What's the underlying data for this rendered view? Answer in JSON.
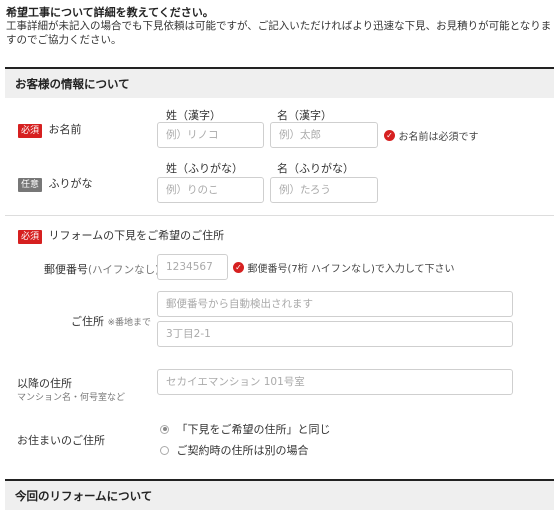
{
  "intro": {
    "title": "希望工事について詳細を教えてください。",
    "text": "工事詳細が未記入の場合でも下見依頼は可能ですが、ご記入いただければより迅速な下見、お見積りが可能となりますのでご協力ください。"
  },
  "customer_section": {
    "heading": "お客様の情報について",
    "name": {
      "badge": "必須",
      "label": "お名前",
      "sei_label": "姓（漢字）",
      "mei_label": "名（漢字）",
      "sei_placeholder": "例）リノコ",
      "mei_placeholder": "例）太郎",
      "error": "お名前は必須です"
    },
    "furigana": {
      "badge": "任意",
      "label": "ふりがな",
      "sei_label": "姓（ふりがな）",
      "mei_label": "名（ふりがな）",
      "sei_placeholder": "例）りのこ",
      "mei_placeholder": "例）たろう"
    }
  },
  "address_section": {
    "badge": "必須",
    "title": "リフォームの下見をご希望のご住所",
    "postal": {
      "label": "郵便番号",
      "label_note": "(ハイフンなし)",
      "placeholder": "1234567",
      "error": "郵便番号(7桁 ハイフンなし)で入力して下さい"
    },
    "address": {
      "label": "ご住所",
      "label_note": "※番地まで",
      "auto_placeholder": "郵便番号から自動検出されます",
      "street_placeholder": "3丁目2-1"
    },
    "building": {
      "label": "以降の住所",
      "label_note": "マンション名・何号室など",
      "placeholder": "セカイエマンション 101号室"
    },
    "residence": {
      "label": "お住まいのご住所",
      "options": [
        "「下見をご希望の住所」と同じ",
        "ご契約時の住所は別の場合"
      ],
      "selected_index": 0
    }
  },
  "reform_section": {
    "heading": "今回のリフォームについて"
  },
  "colors": {
    "required_badge": "#d62020",
    "optional_badge": "#777777",
    "section_bg": "#efefef"
  }
}
